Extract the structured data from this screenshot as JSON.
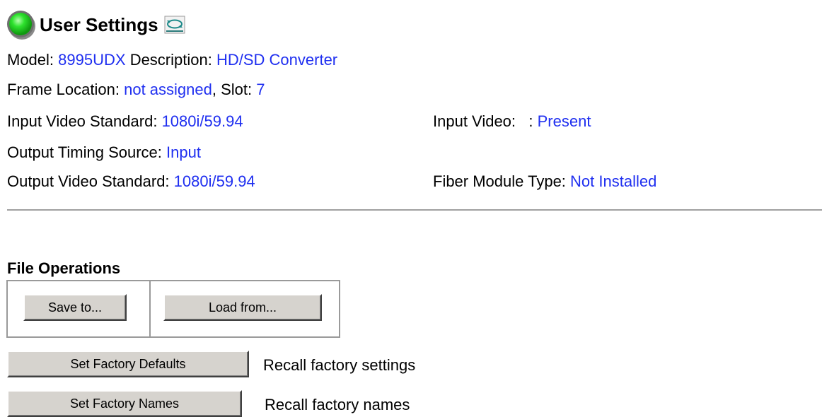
{
  "header": {
    "title": "User Settings"
  },
  "info": {
    "model_label": "Model:",
    "model_value": "8995UDX",
    "description_label": "Description:",
    "description_value": "HD/SD Converter",
    "frame_location_label": "Frame Location:",
    "frame_location_value": "not assigned",
    "slot_label": ", Slot:",
    "slot_value": "7",
    "input_video_standard_label": "Input Video Standard:",
    "input_video_standard_value": "1080i/59.94",
    "input_video_label": "Input Video:   :",
    "input_video_value": "Present",
    "output_timing_source_label": "Output Timing Source:",
    "output_timing_source_value": "Input",
    "output_video_standard_label": "Output Video Standard:",
    "output_video_standard_value": "1080i/59.94",
    "fiber_module_type_label": "Fiber Module Type:",
    "fiber_module_type_value": "Not Installed"
  },
  "file_operations": {
    "title": "File Operations",
    "save_label": "Save to...",
    "load_label": "Load from..."
  },
  "factory": {
    "defaults_label": "Set Factory Defaults",
    "defaults_desc": "Recall factory settings",
    "names_label": "Set Factory Names",
    "names_desc": "Recall factory names"
  },
  "colors": {
    "value_text": "#1f2ff0",
    "status_led": "#22cc22",
    "button_face": "#d6d3ce"
  },
  "icons": {
    "status": "status-led-green-icon",
    "refresh": "refresh-icon"
  }
}
